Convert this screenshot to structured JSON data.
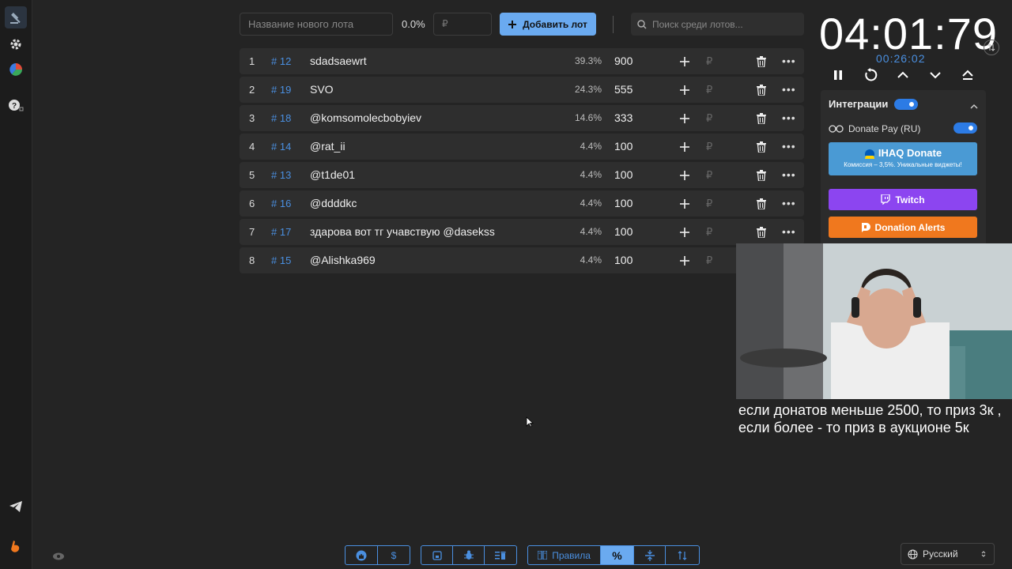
{
  "new_lot": {
    "placeholder": "Название нового лота",
    "percent": "0.0%",
    "amount_placeholder": "₽",
    "add_label": "Добавить лот"
  },
  "search": {
    "placeholder": "Поиск среди лотов..."
  },
  "lots": [
    {
      "index": "1",
      "id": "# 12",
      "name": "sdadsaewrt",
      "percent": "39.3%",
      "amount": "900",
      "currency": "₽"
    },
    {
      "index": "2",
      "id": "# 19",
      "name": "SVO",
      "percent": "24.3%",
      "amount": "555",
      "currency": "₽"
    },
    {
      "index": "3",
      "id": "# 18",
      "name": "@komsomolecbobyiev",
      "percent": "14.6%",
      "amount": "333",
      "currency": "₽"
    },
    {
      "index": "4",
      "id": "# 14",
      "name": "@rat_ii",
      "percent": "4.4%",
      "amount": "100",
      "currency": "₽"
    },
    {
      "index": "5",
      "id": "# 13",
      "name": "@t1de01",
      "percent": "4.4%",
      "amount": "100",
      "currency": "₽"
    },
    {
      "index": "6",
      "id": "# 16",
      "name": "@ddddkc",
      "percent": "4.4%",
      "amount": "100",
      "currency": "₽"
    },
    {
      "index": "7",
      "id": "# 17",
      "name": "здарова вот тг учавствую @dasekss",
      "percent": "4.4%",
      "amount": "100",
      "currency": "₽"
    },
    {
      "index": "8",
      "id": "# 15",
      "name": "@Alishka969",
      "percent": "4.4%",
      "amount": "100",
      "currency": "₽"
    }
  ],
  "timer": {
    "main": "04:01:79",
    "sub": "00:26:02"
  },
  "integrations": {
    "title": "Интеграции",
    "donate_pay": "Donate Pay (RU)",
    "ihaq_title": "IHAQ Donate",
    "ihaq_sub": "Комиссия – 3,5%. Уникальные виджеты!",
    "twitch": "Twitch",
    "donation_alerts": "Donation Alerts"
  },
  "caption": "если донатов меньше 2500, то приз 3к , если более - то приз в аукционе 5к",
  "bottom": {
    "rules": "Правила",
    "percent_symbol": "%",
    "dollar": "$"
  },
  "language": "Русский",
  "colors": {
    "accent": "#4a8fe0",
    "twitch": "#8c45f0",
    "donation_alerts": "#f0781e",
    "ihaq": "#4a9ad4"
  }
}
